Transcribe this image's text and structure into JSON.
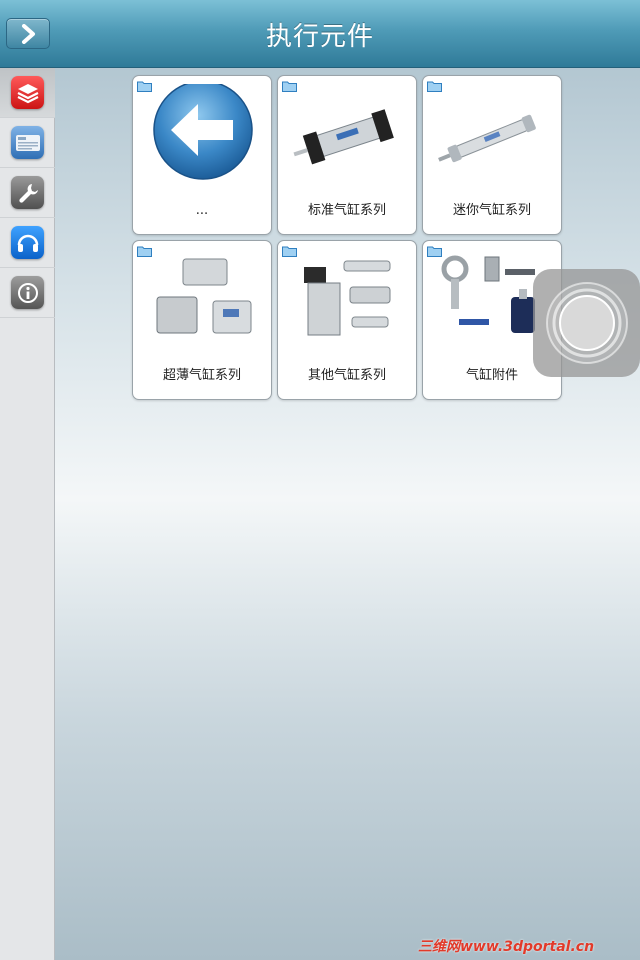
{
  "header": {
    "title": "执行元件",
    "back_icon": "chevron-right-icon"
  },
  "sidebar": {
    "items": [
      {
        "icon": "layers-icon",
        "active": true,
        "color": "#e02626"
      },
      {
        "icon": "news-icon",
        "active": false,
        "color": "#3b79c2"
      },
      {
        "icon": "wrench-icon",
        "active": false,
        "color": "#6c6c6c"
      },
      {
        "icon": "headset-icon",
        "active": false,
        "color": "#1f7fe0"
      },
      {
        "icon": "info-icon",
        "active": false,
        "color": "#6c6c6c"
      }
    ]
  },
  "grid": {
    "items": [
      {
        "label": "...",
        "icon": "back-arrow-icon"
      },
      {
        "label": "标准气缸系列",
        "icon": "standard-cylinder-image"
      },
      {
        "label": "迷你气缸系列",
        "icon": "mini-cylinder-image"
      },
      {
        "label": "超薄气缸系列",
        "icon": "compact-cylinder-image"
      },
      {
        "label": "其他气缸系列",
        "icon": "other-cylinder-image"
      },
      {
        "label": "气缸附件",
        "icon": "cylinder-accessories-image"
      }
    ]
  },
  "watermark": {
    "text": "三维网www.3dportal.cn"
  }
}
